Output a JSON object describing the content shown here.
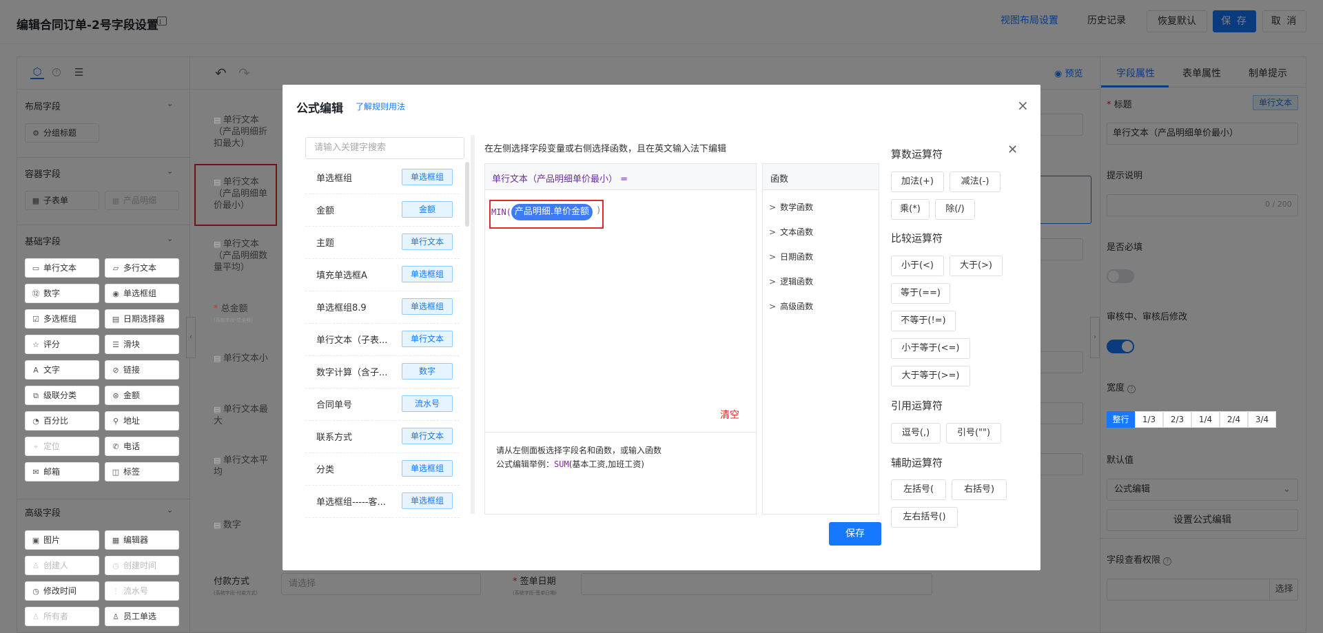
{
  "header": {
    "title": "编辑合同订单-2号字段设置",
    "layout_link": "视图布局设置",
    "history": "历史记录",
    "restore": "恢复默认",
    "save": "保 存",
    "cancel": "取 消"
  },
  "left_panel": {
    "help_glyph": "?",
    "sections": {
      "layout": "布局字段",
      "container": "容器字段",
      "basic": "基础字段",
      "advanced": "高级字段"
    },
    "layout_items": [
      "分组标题"
    ],
    "container_items": [
      "子表单",
      "产品明细"
    ],
    "basic_items": [
      "单行文本",
      "多行文本",
      "数字",
      "单选框组",
      "多选框组",
      "日期选择器",
      "评分",
      "滑块",
      "文字",
      "链接",
      "级联分类",
      "金额",
      "百分比",
      "地址",
      "定位",
      "电话",
      "邮箱",
      "标签"
    ],
    "advanced_items": [
      "图片",
      "编辑器",
      "创建人",
      "创建时间",
      "修改时间",
      "流水号",
      "所有者",
      "员工单选"
    ]
  },
  "canvas": {
    "preview": "预览",
    "fields": [
      {
        "label": "单行文本（产品明细折扣最大）"
      },
      {
        "label": "单行文本（产品明细单价最小）"
      },
      {
        "label": "单行文本（产品明细数量平均）"
      },
      {
        "label": "总金额",
        "sub": "(系统字段-总金额)"
      },
      {
        "label": "单行文本小"
      },
      {
        "label": "单行文本最大"
      },
      {
        "label": "单行文本平均"
      },
      {
        "label": "数字"
      }
    ],
    "bottom_field_left": {
      "label": "付款方式",
      "sub": "(系统字段-付款方式)",
      "placeholder": "请选择"
    },
    "bottom_field_right": {
      "label": "签单日期",
      "sub": "(系统字段-签单日期)"
    }
  },
  "right_panel": {
    "tabs": [
      "字段属性",
      "表单属性",
      "制单提示"
    ],
    "title_label": "标题",
    "title_badge": "单行文本",
    "title_value": "单行文本（产品明细单价最小）",
    "hint_label": "提示说明",
    "hint_count": "0 / 200",
    "required_label": "是否必填",
    "review_label": "审核中、审核后修改",
    "width_label": "宽度",
    "width_options": [
      "整行",
      "1/3",
      "2/3",
      "1/4",
      "2/4",
      "3/4"
    ],
    "default_label": "默认值",
    "default_value": "公式编辑",
    "formula_button": "设置公式编辑",
    "view_perm_label": "字段查看权限",
    "select_button": "选择"
  },
  "modal": {
    "title": "公式编辑",
    "rule_link": "了解规则用法",
    "search_placeholder": "请输入关键字搜索",
    "fields": [
      {
        "name": "单选框组",
        "tag": "单选框组"
      },
      {
        "name": "金额",
        "tag": "金额"
      },
      {
        "name": "主题",
        "tag": "单行文本"
      },
      {
        "name": "填充单选框A",
        "tag": "单选框组"
      },
      {
        "name": "单选框组8.9",
        "tag": "单选框组"
      },
      {
        "name": "单行文本（子表...",
        "tag": "单行文本"
      },
      {
        "name": "数字计算（含子...",
        "tag": "数字"
      },
      {
        "name": "合同单号",
        "tag": "流水号"
      },
      {
        "name": "联系方式",
        "tag": "单行文本"
      },
      {
        "name": "分类",
        "tag": "单选框组"
      },
      {
        "name": "单选框组-----客...",
        "tag": "单选框组"
      }
    ],
    "editor_hint": "在左侧选择字段变量或右侧选择函数，且在英文输入法下编辑",
    "editor_target": "单行文本（产品明细单价最小） =",
    "formula_fn": "MIN(",
    "formula_token": "产品明细.单价金额",
    "formula_close": ")",
    "clear": "清空",
    "help_line1": "请从左侧面板选择字段名和函数，或输入函数",
    "help_line2_prefix": "公式编辑举例：",
    "help_line2_fn": "SUM",
    "help_line2_args": "(基本工资,加班工资)",
    "functions_title": "函数",
    "function_categories": [
      "数学函数",
      "文本函数",
      "日期函数",
      "逻辑函数",
      "高级函数"
    ],
    "operator_groups": {
      "arith": {
        "title": "算数运算符",
        "items": [
          "加法(+)",
          "减法(-)",
          "乘(*)",
          "除(/)"
        ]
      },
      "compare": {
        "title": "比较运算符",
        "items": [
          "小于(<)",
          "大于(>)",
          "等于(==)",
          "不等于(!=)",
          "小于等于(<=)",
          "大于等于(>=)"
        ]
      },
      "ref": {
        "title": "引用运算符",
        "items": [
          "逗号(,)",
          "引号(\"\")"
        ]
      },
      "aux": {
        "title": "辅助运算符",
        "items": [
          "左括号(",
          "右括号)",
          "左右括号()"
        ]
      }
    },
    "save": "保存"
  },
  "colors": {
    "primary": "#1677ff",
    "danger": "#e5262a",
    "formula_purple": "#6b2fa0"
  }
}
